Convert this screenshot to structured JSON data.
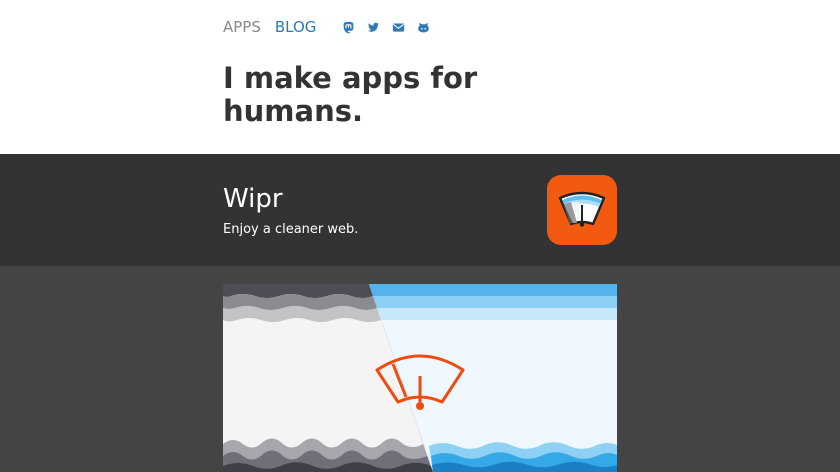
{
  "nav": {
    "apps_label": "APPS",
    "blog_label": "BLOG",
    "social_icons": [
      "mastodon-icon",
      "twitter-icon",
      "email-icon",
      "github-icon"
    ]
  },
  "hero": {
    "headline": "I make apps for humans."
  },
  "app": {
    "name": "Wipr",
    "tagline": "Enjoy a cleaner web.",
    "icon": "wipr-app-icon"
  },
  "colors": {
    "link": "#2f79b5",
    "muted": "#8a8a8a",
    "band_dark": "#333333",
    "band_mid": "#444444",
    "brand_orange": "#f25a12"
  }
}
